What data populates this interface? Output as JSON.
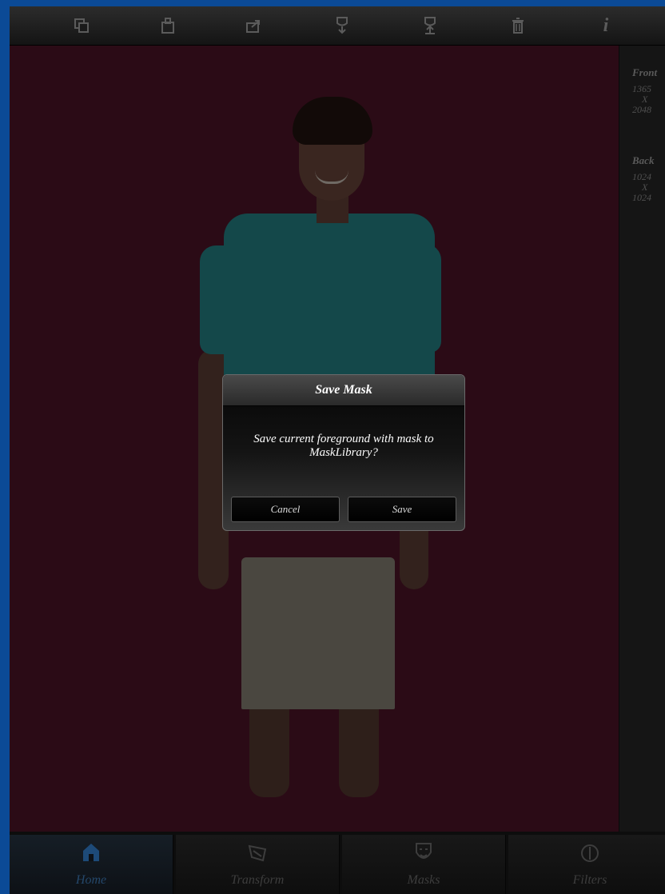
{
  "toolbar": {
    "icons": [
      "duplicate-icon",
      "clipboard-icon",
      "share-icon",
      "import-mask-icon",
      "export-mask-icon",
      "trash-icon",
      "info-icon"
    ],
    "info_glyph": "i"
  },
  "side_panel": {
    "front": {
      "heading": "Front",
      "width": "1365",
      "x": "X",
      "height": "2048"
    },
    "back": {
      "heading": "Back",
      "width": "1024",
      "x": "X",
      "height": "1024"
    }
  },
  "dialog": {
    "title": "Save Mask",
    "message": "Save current foreground with mask to MaskLibrary?",
    "cancel_label": "Cancel",
    "save_label": "Save"
  },
  "tabs": [
    {
      "label": "Home",
      "icon": "home-icon",
      "active": true
    },
    {
      "label": "Transform",
      "icon": "transform-icon",
      "active": false
    },
    {
      "label": "Masks",
      "icon": "mask-icon",
      "active": false
    },
    {
      "label": "Filters",
      "icon": "filters-icon",
      "active": false
    }
  ],
  "colors": {
    "canvas": "#2b0b16",
    "active_tab": "#1d4a78",
    "frame_border": "#0b4a96"
  }
}
